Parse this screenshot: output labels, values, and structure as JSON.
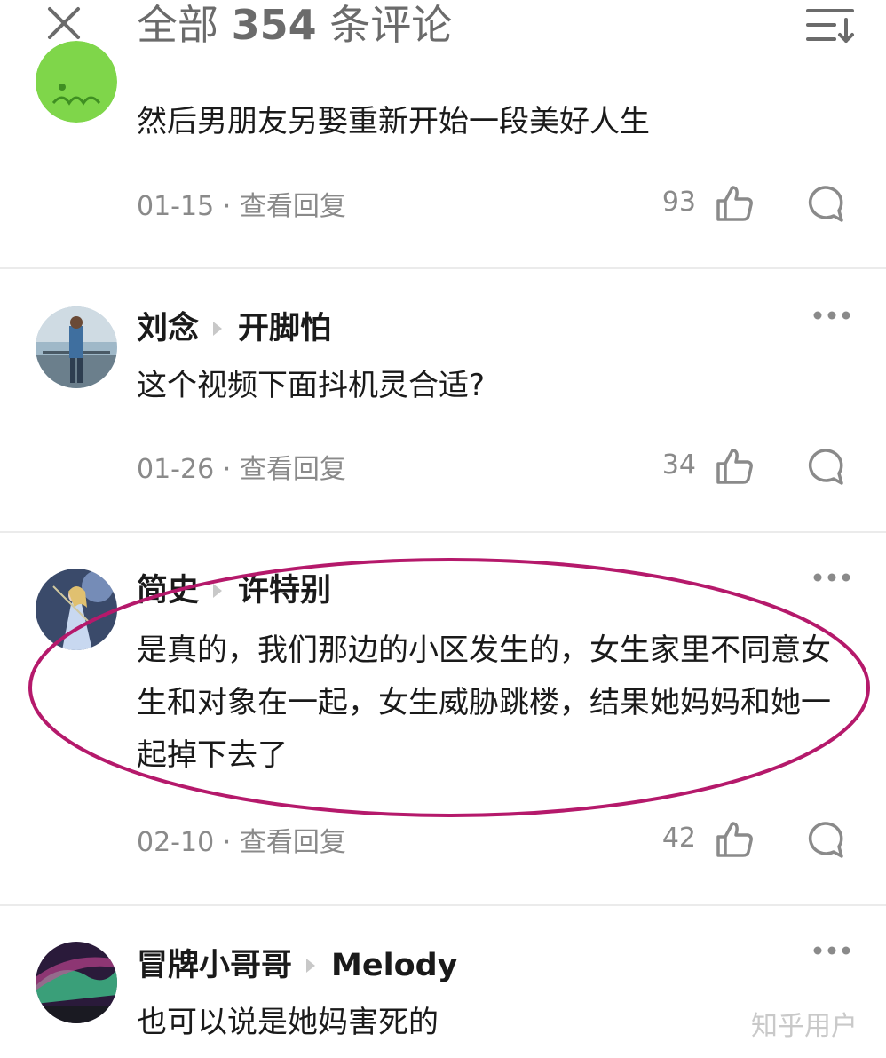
{
  "header": {
    "title_prefix": "全部",
    "count": "354",
    "title_suffix": "条评论",
    "close_icon": "close-icon",
    "sort_icon": "sort-icon"
  },
  "comments": [
    {
      "avatar": "avatar-green-cartoon",
      "content": "然后男朋友另娶重新开始一段美好人生",
      "date": "01-15",
      "separator": "·",
      "reply_label": "查看回复",
      "likes": "93"
    },
    {
      "avatar": "avatar-photographer",
      "user": "刘念",
      "reply_to": "开脚怕",
      "content": "这个视频下面抖机灵合适?",
      "date": "01-26",
      "separator": "·",
      "reply_label": "查看回复",
      "likes": "34"
    },
    {
      "avatar": "avatar-anime-violinist",
      "user": "简史",
      "reply_to": "许特别",
      "content": "是真的，我们那边的小区发生的，女生家里不同意女生和对象在一起，女生威胁跳楼，结果她妈妈和她一起掉下去了",
      "date": "02-10",
      "separator": "·",
      "reply_label": "查看回复",
      "likes": "42",
      "highlighted": true
    },
    {
      "avatar": "avatar-aurora",
      "user": "冒牌小哥哥",
      "reply_to": "Melody",
      "content": "也可以说是她妈害死的"
    }
  ],
  "watermark": "知乎用户",
  "colors": {
    "title_gray": "#6b6b6b",
    "meta_gray": "#8a8a8a",
    "highlight_ellipse": "#b5196b",
    "divider": "#ebebeb"
  },
  "icons": {
    "like": "thumbs-up-icon",
    "reply": "comment-bubble-icon",
    "more": "more-dots-icon",
    "arrow": "reply-arrow-icon"
  }
}
